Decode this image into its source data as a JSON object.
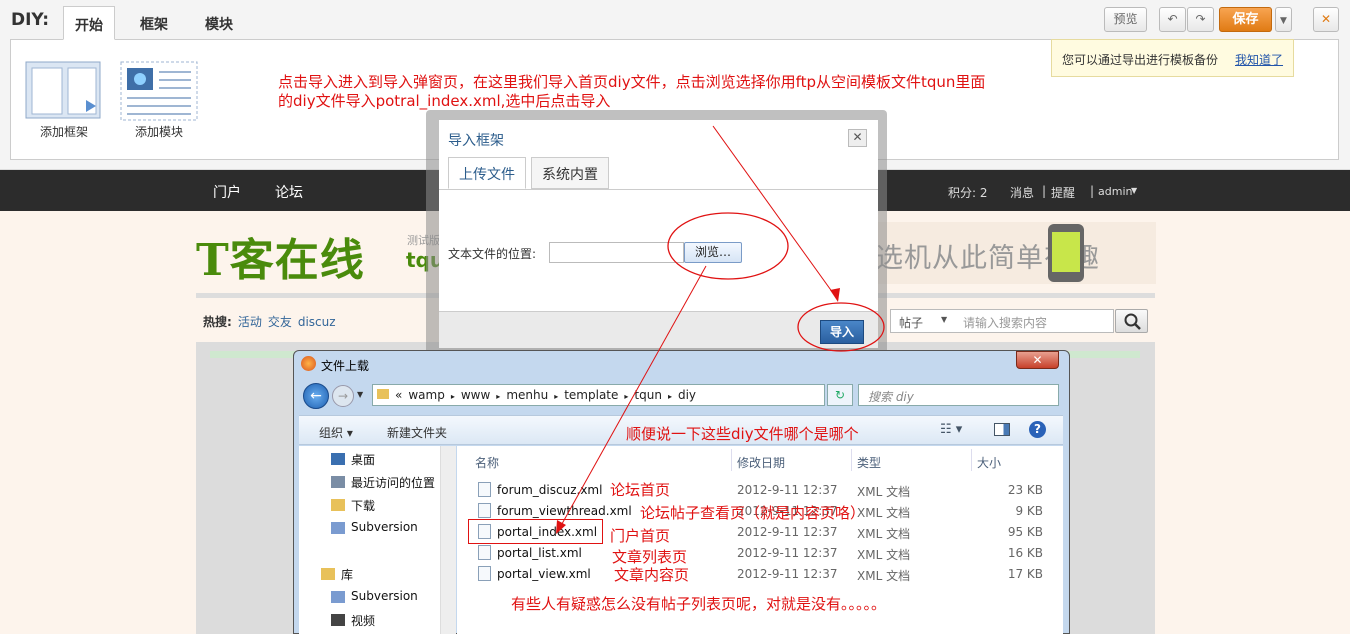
{
  "diy": {
    "label": "DIY:",
    "tabs": [
      "开始",
      "框架",
      "模块"
    ],
    "add_frame": "添加框架",
    "add_module": "添加模块",
    "preview": "预览",
    "save": "保存",
    "close_icon": "✕",
    "tooltip": "您可以通过导出进行模板备份",
    "tooltip_link": "我知道了"
  },
  "nav": {
    "items": [
      "门户",
      "论坛"
    ],
    "score": "积分: 2",
    "msg": "消息",
    "sep": "|",
    "remind": "提醒",
    "user": "admin"
  },
  "site": {
    "logo": "T客在线",
    "logo_sub": "测试版",
    "logo_sub2": "tqu",
    "banner": "选机从此简单有趣",
    "hot_label": "热搜:",
    "hot": [
      "活动",
      "交友",
      "discuz"
    ],
    "search_type": "帖子",
    "search_placeholder": "请输入搜索内容"
  },
  "annotations": {
    "main1": "点击导入进入到导入弹窗页，在这里我们导入首页diy文件，点击浏览选择你用ftp从空间模板文件tqun里面",
    "main2": "的diy文件导入potral_index.xml,选中后点击导入",
    "which": "顺便说一下这些diy文件哪个是哪个",
    "forum_home": "论坛首页",
    "forum_thread": "论坛帖子查看页（就是内容页咯）",
    "portal_home": "门户首页",
    "article_list": "文章列表页",
    "article_view": "文章内容页",
    "doubt": "有些人有疑惑怎么没有帖子列表页呢，对就是没有。。。。。"
  },
  "import_dialog": {
    "title": "导入框架",
    "tabs": [
      "上传文件",
      "系统内置"
    ],
    "file_label": "文本文件的位置:",
    "browse": "浏览…",
    "import": "导入",
    "close": "✕"
  },
  "file_dialog": {
    "title": "文件上载",
    "close": "✕",
    "path": [
      "«",
      "wamp",
      "www",
      "menhu",
      "template",
      "tqun",
      "diy"
    ],
    "search_placeholder": "搜索 diy",
    "organize": "组织 ▾",
    "new_folder": "新建文件夹",
    "tree": [
      "桌面",
      "最近访问的位置",
      "下载",
      "Subversion",
      "库",
      "Subversion",
      "视频"
    ],
    "columns": [
      "名称",
      "修改日期",
      "类型",
      "大小"
    ],
    "files": [
      {
        "name": "forum_discuz.xml",
        "date": "2012-9-11 12:37",
        "type": "XML 文档",
        "size": "23 KB"
      },
      {
        "name": "forum_viewthread.xml",
        "date": "2012-9-11 12:37",
        "type": "XML 文档",
        "size": "9 KB"
      },
      {
        "name": "portal_index.xml",
        "date": "2012-9-11 12:37",
        "type": "XML 文档",
        "size": "95 KB"
      },
      {
        "name": "portal_list.xml",
        "date": "2012-9-11 12:37",
        "type": "XML 文档",
        "size": "16 KB"
      },
      {
        "name": "portal_view.xml",
        "date": "2012-9-11 12:37",
        "type": "XML 文档",
        "size": "17 KB"
      }
    ]
  },
  "colors": {
    "accent": "#e07b14",
    "annotation": "#e01212",
    "nav_bg": "#2c2c2c",
    "logo": "#4a8b0c"
  }
}
